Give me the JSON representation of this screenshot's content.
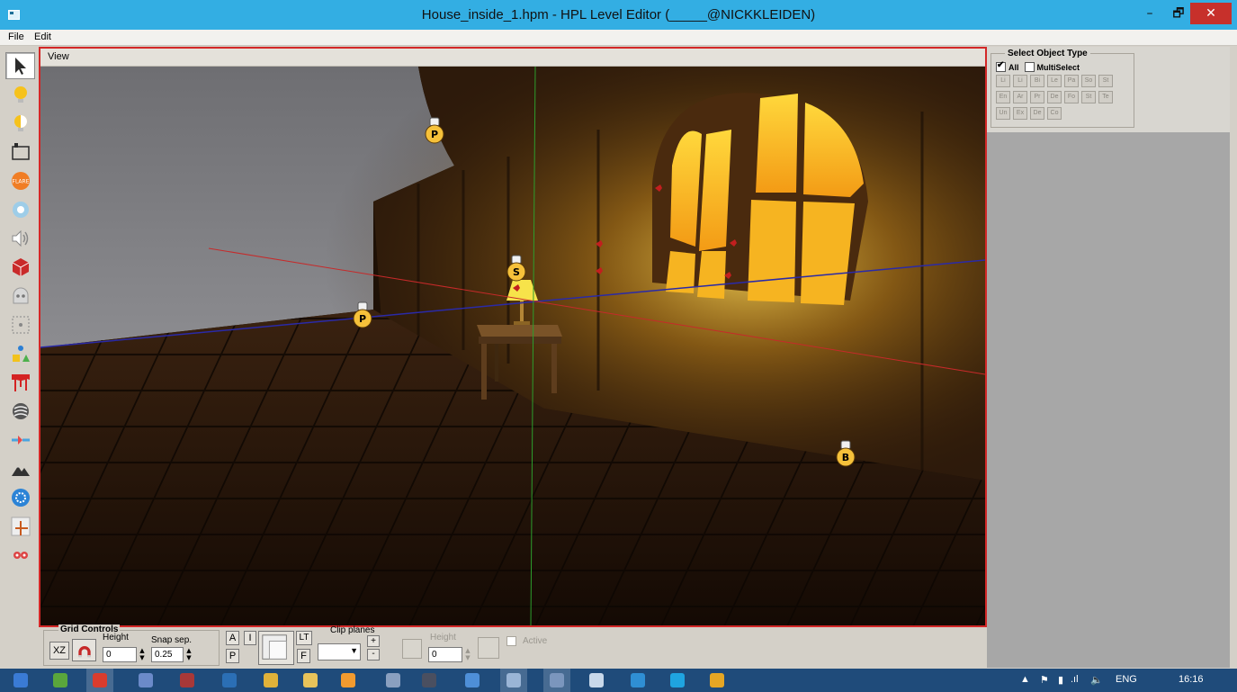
{
  "window": {
    "title": "House_inside_1.hpm - HPL Level Editor (_____@NICKKLEIDEN)",
    "minimize_label": "–",
    "maximize_label": "🗗",
    "close_label": "✕"
  },
  "menu": {
    "file": "File",
    "edit": "Edit"
  },
  "toolbar": {
    "tools": [
      {
        "icon": "cursor-icon"
      },
      {
        "icon": "light-bulb-icon"
      },
      {
        "icon": "light-bulb-half-icon"
      },
      {
        "icon": "billboard-icon"
      },
      {
        "icon": "flare-icon"
      },
      {
        "icon": "particle-icon"
      },
      {
        "icon": "sound-icon"
      },
      {
        "icon": "static-object-icon"
      },
      {
        "icon": "entity-icon"
      },
      {
        "icon": "area-icon"
      },
      {
        "icon": "primitive-icon"
      },
      {
        "icon": "decal-icon"
      },
      {
        "icon": "fog-icon"
      },
      {
        "icon": "combine-icon"
      },
      {
        "icon": "terrain-icon"
      },
      {
        "icon": "skybox-icon"
      },
      {
        "icon": "editor-grid-icon"
      },
      {
        "icon": "group-icon"
      }
    ],
    "flare_text": "FLARE"
  },
  "view": {
    "label": "View",
    "markers": [
      {
        "letter": "P"
      },
      {
        "letter": "S"
      },
      {
        "letter": "P"
      },
      {
        "letter": "B"
      }
    ]
  },
  "select_object_type": {
    "legend": "Select Object Type",
    "all_label": "All",
    "all_checked": true,
    "multiselect_label": "MultiSelect",
    "multiselect_checked": false,
    "types": [
      "Li",
      "Li",
      "Bi",
      "Le",
      "Pa",
      "So",
      "St",
      "En",
      "Ar",
      "Pr",
      "De",
      "Fo",
      "St",
      "Te",
      "Un",
      "Ex",
      "De",
      "Co"
    ]
  },
  "bottom": {
    "grid_controls_label": "Grid Controls",
    "plane_button": "XZ",
    "height_label": "Height",
    "height_value": "0",
    "snap_label": "Snap sep.",
    "snap_value": "0.25",
    "view_btn_a": "A",
    "view_btn_i": "I",
    "view_btn_p": "P",
    "view_btn_lt": "LT",
    "view_btn_f": "F",
    "clip_planes_label": "Clip planes",
    "clip_add": "+",
    "clip_remove": "-",
    "clip_height_label": "Height",
    "clip_height_value": "0",
    "active_label": "Active"
  },
  "taskbar": {
    "language": "ENG",
    "time": "16:16",
    "items": [
      {
        "icon": "windows-start-icon",
        "color": "#3a7bd5"
      },
      {
        "icon": "browser-icon",
        "color": "#5aa63c"
      },
      {
        "icon": "opera-icon",
        "color": "#d93c2d"
      },
      {
        "icon": "window-app-icon",
        "color": "#6b8ac9"
      },
      {
        "icon": "game-icon",
        "color": "#a83838"
      },
      {
        "icon": "photoshop-icon",
        "color": "#2b6fb5"
      },
      {
        "icon": "chrome-icon",
        "color": "#e0b23a"
      },
      {
        "icon": "explorer-icon",
        "color": "#e8c35a"
      },
      {
        "icon": "level-editor-icon",
        "color": "#f39b2f"
      },
      {
        "icon": "tools-icon",
        "color": "#8aa0c0"
      },
      {
        "icon": "steam-icon",
        "color": "#4a4f60"
      },
      {
        "icon": "network-icon",
        "color": "#4e8fd8"
      },
      {
        "icon": "hpl-window-icon",
        "color": "#9ab5d6"
      },
      {
        "icon": "hpl-window-2-icon",
        "color": "#7b96bd"
      },
      {
        "icon": "document-icon",
        "color": "#c8d8ea"
      },
      {
        "icon": "globe-icon",
        "color": "#2f8fd4"
      },
      {
        "icon": "skype-icon",
        "color": "#1fa4e0"
      },
      {
        "icon": "security-icon",
        "color": "#e5a624"
      }
    ]
  }
}
